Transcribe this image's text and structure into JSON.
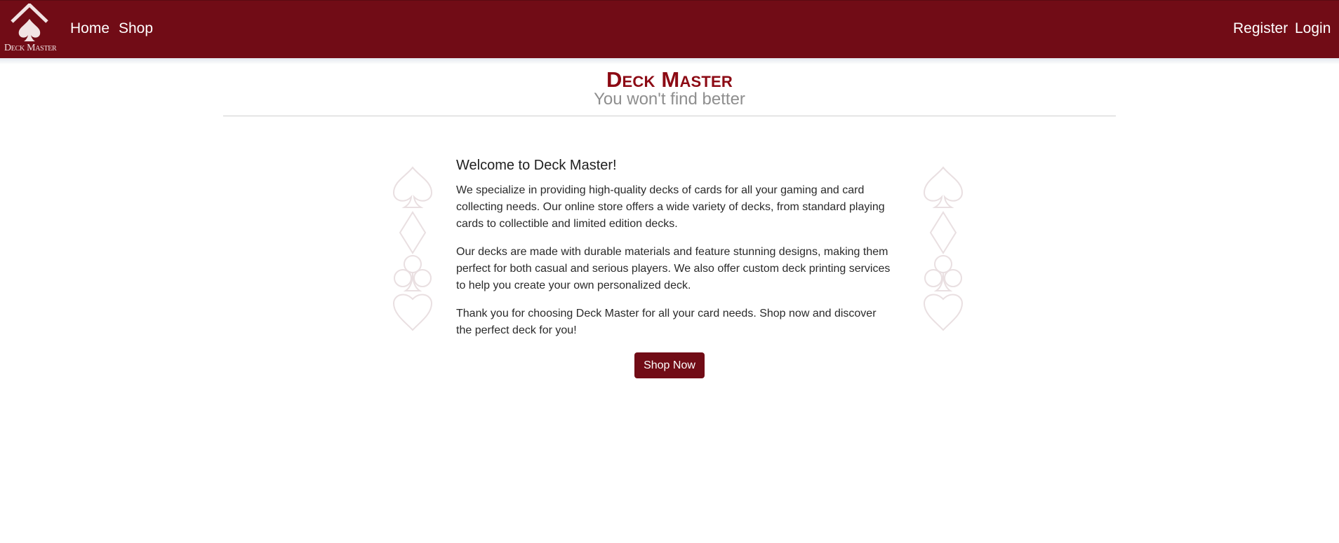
{
  "nav": {
    "brand_text": "Deck Master",
    "home_label": "Home",
    "shop_label": "Shop",
    "register_label": "Register",
    "login_label": "Login"
  },
  "hero": {
    "title": "Deck Master",
    "subtitle": "You won't find better"
  },
  "welcome": {
    "heading": "Welcome to Deck Master!",
    "paragraphs": [
      "We specialize in providing high-quality decks of cards for all your gaming and card collecting needs. Our online store offers a wide variety of decks, from standard playing cards to collectible and limited edition decks.",
      "Our decks are made with durable materials and feature stunning designs, making them perfect for both casual and serious players. We also offer custom deck printing services to help you create your own personalized deck.",
      "Thank you for choosing Deck Master for all your card needs. Shop now and discover the perfect deck for you!"
    ],
    "button_label": "Shop Now"
  },
  "decor": {
    "suits": [
      "spade-icon",
      "diamond-icon",
      "club-icon",
      "heart-icon"
    ]
  },
  "colors": {
    "brand": "#710c16",
    "title": "#8c0a14",
    "subtitle": "#8e8e8e",
    "suit_outline": "#e9dfe1"
  }
}
